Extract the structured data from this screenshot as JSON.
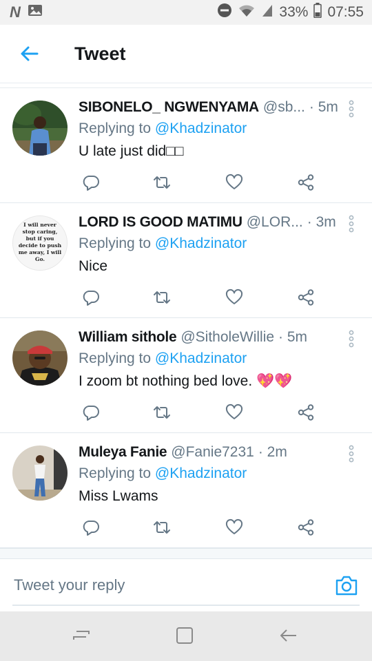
{
  "status_bar": {
    "battery": "33%",
    "time": "07:55",
    "icons": [
      "netflix-n-icon",
      "gallery-icon",
      "do-not-disturb-icon",
      "wifi-icon",
      "signal-icon",
      "battery-icon"
    ]
  },
  "header": {
    "title": "Tweet",
    "back_icon": "back-arrow-icon"
  },
  "tweets": [
    {
      "name": "SIBONELO_ NGWENYAMA",
      "handle": "@sb...",
      "time": "· 5m",
      "replying_prefix": "Replying to",
      "replying_to": "@Khadzinator",
      "text": "U late just did□□"
    },
    {
      "name": "LORD IS GOOD MATIMU",
      "handle": "@LOR...",
      "time": "· 3m",
      "replying_prefix": "Replying to",
      "replying_to": "@Khadzinator",
      "text": "Nice",
      "avatar_text": "I will never stop caring, but if you decide to push me away, I will Go."
    },
    {
      "name": "William sithole",
      "handle": "@SitholeWillie",
      "time": "· 5m",
      "replying_prefix": "Replying to",
      "replying_to": "@Khadzinator",
      "text": "I zoom bt nothing bed love. ",
      "emoji": "💖💖"
    },
    {
      "name": "Muleya Fanie",
      "handle": "@Fanie7231",
      "time": "· 2m",
      "replying_prefix": "Replying to",
      "replying_to": "@Khadzinator",
      "text": "Miss Lwams"
    }
  ],
  "composer": {
    "placeholder": "Tweet your reply",
    "camera_icon": "camera-icon"
  },
  "nav_bar": {
    "buttons": [
      "recent-apps-icon",
      "home-icon",
      "back-icon"
    ]
  },
  "colors": {
    "accent": "#1da1f2",
    "secondary_text": "#657786",
    "primary_text": "#14171a"
  }
}
